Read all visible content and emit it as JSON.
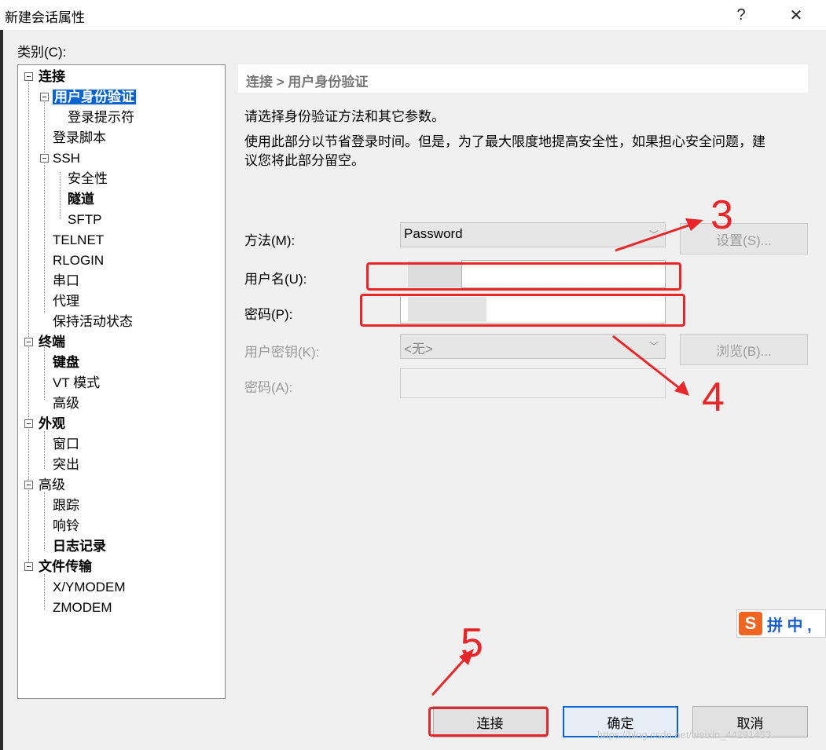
{
  "window": {
    "title": "新建会话属性",
    "help_button": "?",
    "close_button": "✕"
  },
  "category_label": "类别(C):",
  "tree": {
    "items": [
      {
        "label": "连接"
      },
      {
        "label": "用户身份验证"
      },
      {
        "label": "登录提示符"
      },
      {
        "label": "登录脚本"
      },
      {
        "label": "SSH"
      },
      {
        "label": "安全性"
      },
      {
        "label": "隧道"
      },
      {
        "label": "SFTP"
      },
      {
        "label": "TELNET"
      },
      {
        "label": "RLOGIN"
      },
      {
        "label": "串口"
      },
      {
        "label": "代理"
      },
      {
        "label": "保持活动状态"
      },
      {
        "label": "终端"
      },
      {
        "label": "键盘"
      },
      {
        "label": "VT 模式"
      },
      {
        "label": "高级"
      },
      {
        "label": "外观"
      },
      {
        "label": "窗口"
      },
      {
        "label": "突出"
      },
      {
        "label": "高级"
      },
      {
        "label": "跟踪"
      },
      {
        "label": "响铃"
      },
      {
        "label": "日志记录"
      },
      {
        "label": "文件传输"
      },
      {
        "label": "X/YMODEM"
      },
      {
        "label": "ZMODEM"
      }
    ]
  },
  "panel": {
    "breadcrumb": "连接 > 用户身份验证",
    "intro": "请选择身份验证方法和其它参数。",
    "description_line1": "使用此部分以节省登录时间。但是，为了最大限度地提高安全性，如果担心安全问题，建",
    "description_line2": "议您将此部分留空。",
    "method_label": "方法(M):",
    "method_value": "Password",
    "settings_button": "设置(S)...",
    "username_label": "用户名(U):",
    "password_label": "密码(P):",
    "userkey_label": "用户密钥(K):",
    "userkey_value": "<无>",
    "browse_button": "浏览(B)...",
    "passphrase_label": "密码(A):"
  },
  "footer": {
    "connect_button": "连接",
    "ok_button": "确定",
    "cancel_button": "取消"
  },
  "annotations": {
    "step3": "3",
    "step4": "4",
    "step5": "5",
    "color": "#e8262a"
  },
  "ime": {
    "logo": "S",
    "text": "拼 中 ,"
  },
  "watermark": "https://blog.csdn.net/weixin_44291453"
}
